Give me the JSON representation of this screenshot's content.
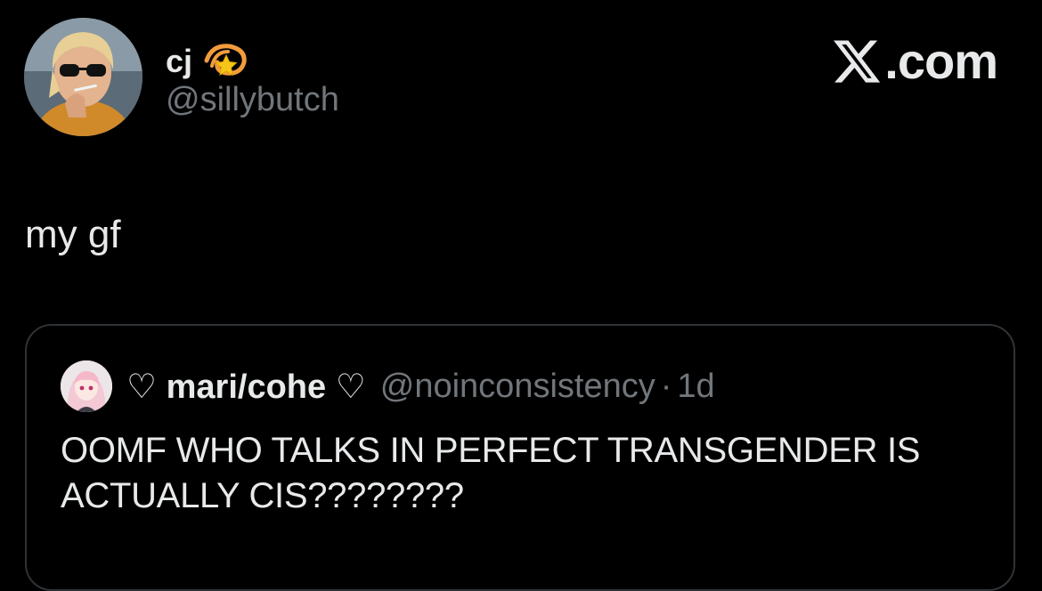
{
  "author": {
    "display_name": "cj",
    "badge_emoji": "dizzy-star-emoji",
    "handle": "@sillybutch",
    "avatar_icon": "user-avatar-photo"
  },
  "brand": {
    "label": ".com",
    "icon": "x-logo-icon"
  },
  "post": {
    "text": "my gf"
  },
  "quoted_post": {
    "display_name": "♡ mari/cohe ♡",
    "handle": "@noinconsistency",
    "separator": "·",
    "time": "1d",
    "text": "OOMF WHO TALKS IN PERFECT TRANSGENDER IS ACTUALLY CIS????????",
    "avatar_icon": "anime-avatar-photo"
  },
  "colors": {
    "background": "#000000",
    "primary_text": "#e7e9ea",
    "secondary_text": "#71767b",
    "border": "#2f3336",
    "star_yellow": "#f5c518",
    "swirl_orange": "#f39c3c"
  }
}
